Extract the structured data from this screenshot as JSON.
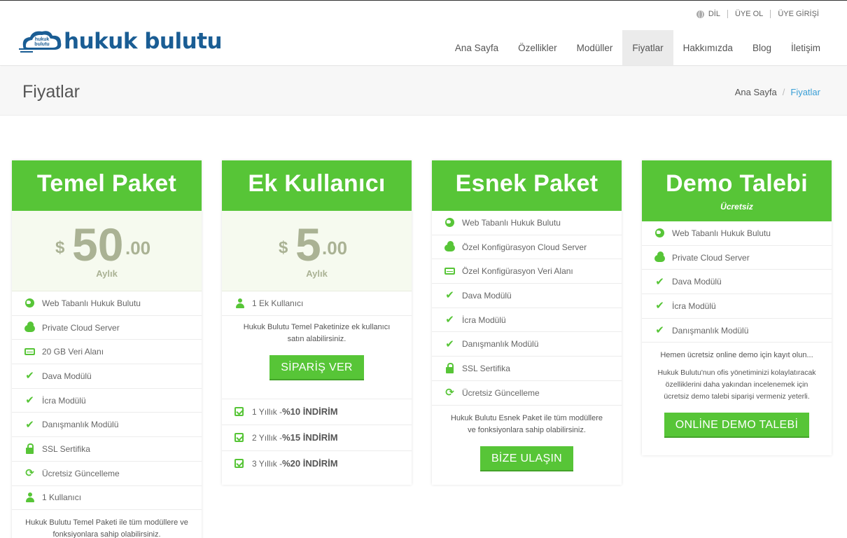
{
  "topbar": {
    "language": "DİL",
    "register": "ÜYE OL",
    "login": "ÜYE GİRİŞİ"
  },
  "logo": {
    "text": "hukuk bulutu",
    "badge": "hukuk bulutu"
  },
  "nav": [
    "Ana Sayfa",
    "Özellikler",
    "Modüller",
    "Fiyatlar",
    "Hakkımızda",
    "Blog",
    "İletişim"
  ],
  "page": {
    "title": "Fiyatlar"
  },
  "breadcrumb": {
    "home": "Ana Sayfa",
    "current": "Fiyatlar"
  },
  "accent_color": "#57c537",
  "cards": [
    {
      "name": "Temel Paket",
      "currency": "$",
      "price": "50",
      "cents": ".00",
      "period": "Aylık",
      "features": [
        {
          "icon": "globe-icon",
          "text": "Web Tabanlı Hukuk Bulutu"
        },
        {
          "icon": "cloud-icon",
          "text": "Private Cloud Server"
        },
        {
          "icon": "hdd-icon",
          "text": "20 GB Veri Alanı"
        },
        {
          "icon": "check-icon",
          "text": "Dava Modülü"
        },
        {
          "icon": "check-icon",
          "text": "İcra Modülü"
        },
        {
          "icon": "check-icon",
          "text": "Danışmanlık Modülü"
        },
        {
          "icon": "lock-icon",
          "text": "SSL Sertifika"
        },
        {
          "icon": "refresh-icon",
          "text": "Ücretsiz Güncelleme"
        },
        {
          "icon": "user-icon",
          "text": "1 Kullanıcı"
        }
      ],
      "note": "Hukuk Bulutu Temel Paketi ile tüm modüllere ve fonksiyonlara sahip olabilirsiniz."
    },
    {
      "name": "Ek Kullanıcı",
      "currency": "$",
      "price": "5",
      "cents": ".00",
      "period": "Aylık",
      "features": [
        {
          "icon": "user-icon",
          "text": "1 Ek Kullanıcı"
        }
      ],
      "note": "Hukuk Bulutu Temel Paketinize ek kullanıcı satın alabilirsiniz.",
      "button": "SİPARİŞ VER",
      "discounts": [
        {
          "period": "1 Yıllık - ",
          "amount": "%10 İNDİRİM"
        },
        {
          "period": "2 Yıllık - ",
          "amount": "%15 İNDİRİM"
        },
        {
          "period": "3 Yıllık - ",
          "amount": "%20 İNDİRİM"
        }
      ]
    },
    {
      "name": "Esnek Paket",
      "features": [
        {
          "icon": "globe-icon",
          "text": "Web Tabanlı Hukuk Bulutu"
        },
        {
          "icon": "cloud-icon",
          "text": "Özel Konfigürasyon Cloud Server"
        },
        {
          "icon": "hdd-icon",
          "text": "Özel Konfigürasyon Veri Alanı"
        },
        {
          "icon": "check-icon",
          "text": "Dava Modülü"
        },
        {
          "icon": "check-icon",
          "text": "İcra Modülü"
        },
        {
          "icon": "check-icon",
          "text": "Danışmanlık Modülü"
        },
        {
          "icon": "lock-icon",
          "text": "SSL Sertifika"
        },
        {
          "icon": "refresh-icon",
          "text": "Ücretsiz Güncelleme"
        }
      ],
      "note": "Hukuk Bulutu Esnek Paket ile tüm modüllere ve fonksiyonlara sahip olabilirsiniz.",
      "button": "BİZE ULAŞIN"
    },
    {
      "name": "Demo Talebi",
      "subtitle": "Ücretsiz",
      "features": [
        {
          "icon": "globe-icon",
          "text": "Web Tabanlı Hukuk Bulutu"
        },
        {
          "icon": "cloud-icon",
          "text": "Private Cloud Server"
        },
        {
          "icon": "check-icon",
          "text": "Dava Modülü"
        },
        {
          "icon": "check-icon",
          "text": "İcra Modülü"
        },
        {
          "icon": "check-icon",
          "text": "Danışmanlık Modülü"
        }
      ],
      "note_top": "Hemen ücretsiz online demo için kayıt olun...",
      "note": "Hukuk Bulutu'nun ofis yönetiminizi kolaylatıracak özelliklerini daha yakından incelenemek için ücretsiz demo talebi siparişi vermeniz yeterli.",
      "button": "ONLİNE DEMO TALEBİ"
    }
  ]
}
